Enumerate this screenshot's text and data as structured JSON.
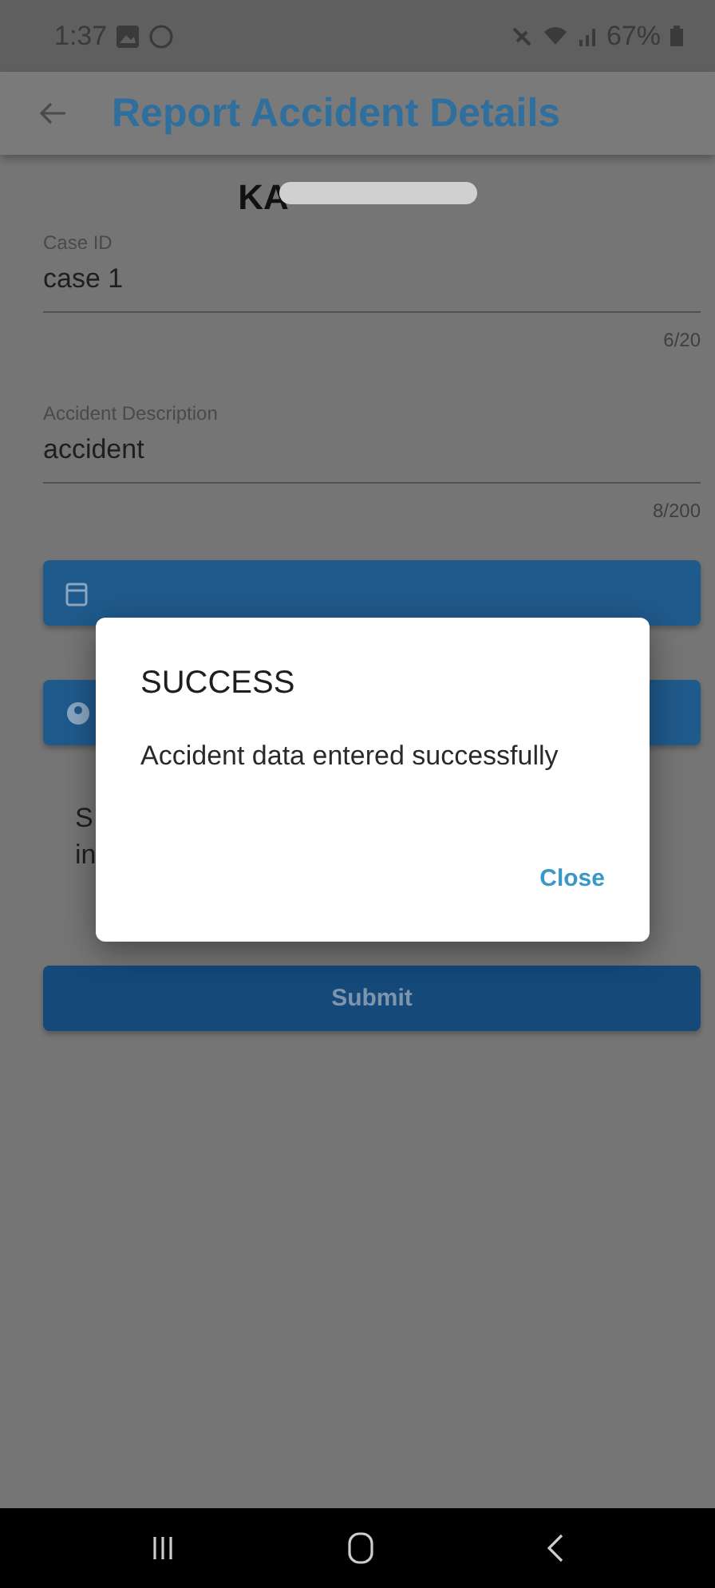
{
  "status_bar": {
    "time": "1:37",
    "battery": "67%"
  },
  "app_bar": {
    "title": "Report Accident Details"
  },
  "vehicle": {
    "number_visible": "KA"
  },
  "fields": [
    {
      "label": "Case ID",
      "value": "case 1",
      "counter": "6/20"
    },
    {
      "label": "Accident Description",
      "value": "accident",
      "counter": "8/200"
    }
  ],
  "pickers": [
    {
      "kind": "date"
    },
    {
      "kind": "person"
    }
  ],
  "note_visible_lines": [
    "S",
    "in"
  ],
  "submit": {
    "label": "Submit"
  },
  "dialog": {
    "title": "SUCCESS",
    "message": "Accident data entered successfully",
    "action": "Close"
  }
}
